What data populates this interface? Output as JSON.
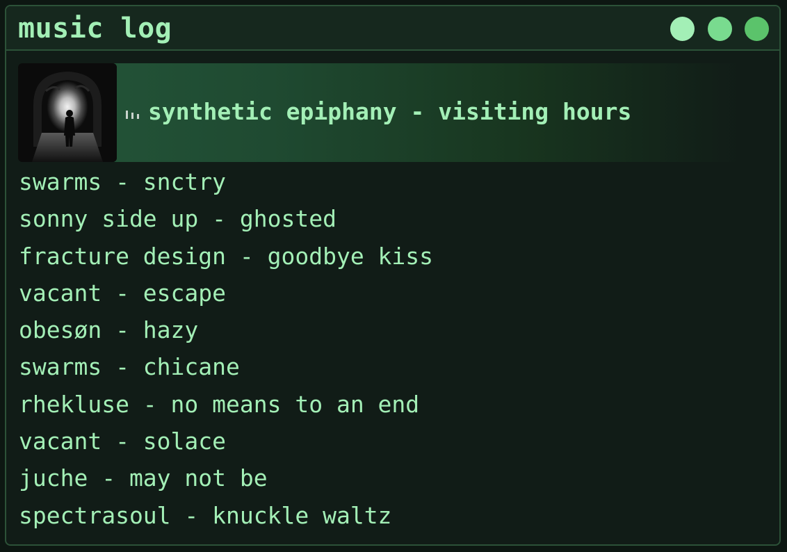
{
  "window": {
    "title": "music log"
  },
  "window_controls": {
    "colors": [
      "#a3efb6",
      "#79db8f",
      "#5bc36b"
    ]
  },
  "now_playing": {
    "track": "synthetic epiphany - visiting hours",
    "album_art_icon": "album-art-tunnel-silhouette",
    "playing_indicator_icon": "equalizer-bars-icon"
  },
  "tracks": [
    "swarms - snctry",
    "sonny side up - ghosted",
    "fracture design - goodbye kiss",
    "vacant - escape",
    "obesøn - hazy",
    "swarms - chicane",
    "rhekluse - no means to an end",
    "vacant - solace",
    "juche - may not be",
    "spectrasoul - knuckle waltz"
  ],
  "colors": {
    "accent_text": "#a3efb6",
    "background": "#111c17",
    "border": "#2c5238",
    "highlight": "#24563a"
  }
}
